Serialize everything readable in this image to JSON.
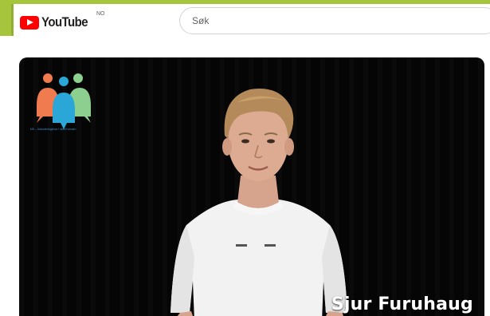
{
  "header": {
    "logo_text": "YouTube",
    "region_code": "NO",
    "search_placeholder": "Søk"
  },
  "video": {
    "channel_logo_caption": "NS – Inkluderingshub i ideell verden",
    "name_overlay": "Sjur Furuhaug"
  },
  "colors": {
    "frame_accent": "#a6c43c",
    "youtube_red": "#ff0000",
    "logo_orange": "#f07b4f",
    "logo_blue": "#2aa7d6",
    "logo_green": "#8ccf8e"
  },
  "icons": [
    "youtube-play-icon",
    "channel-logo-icon"
  ]
}
